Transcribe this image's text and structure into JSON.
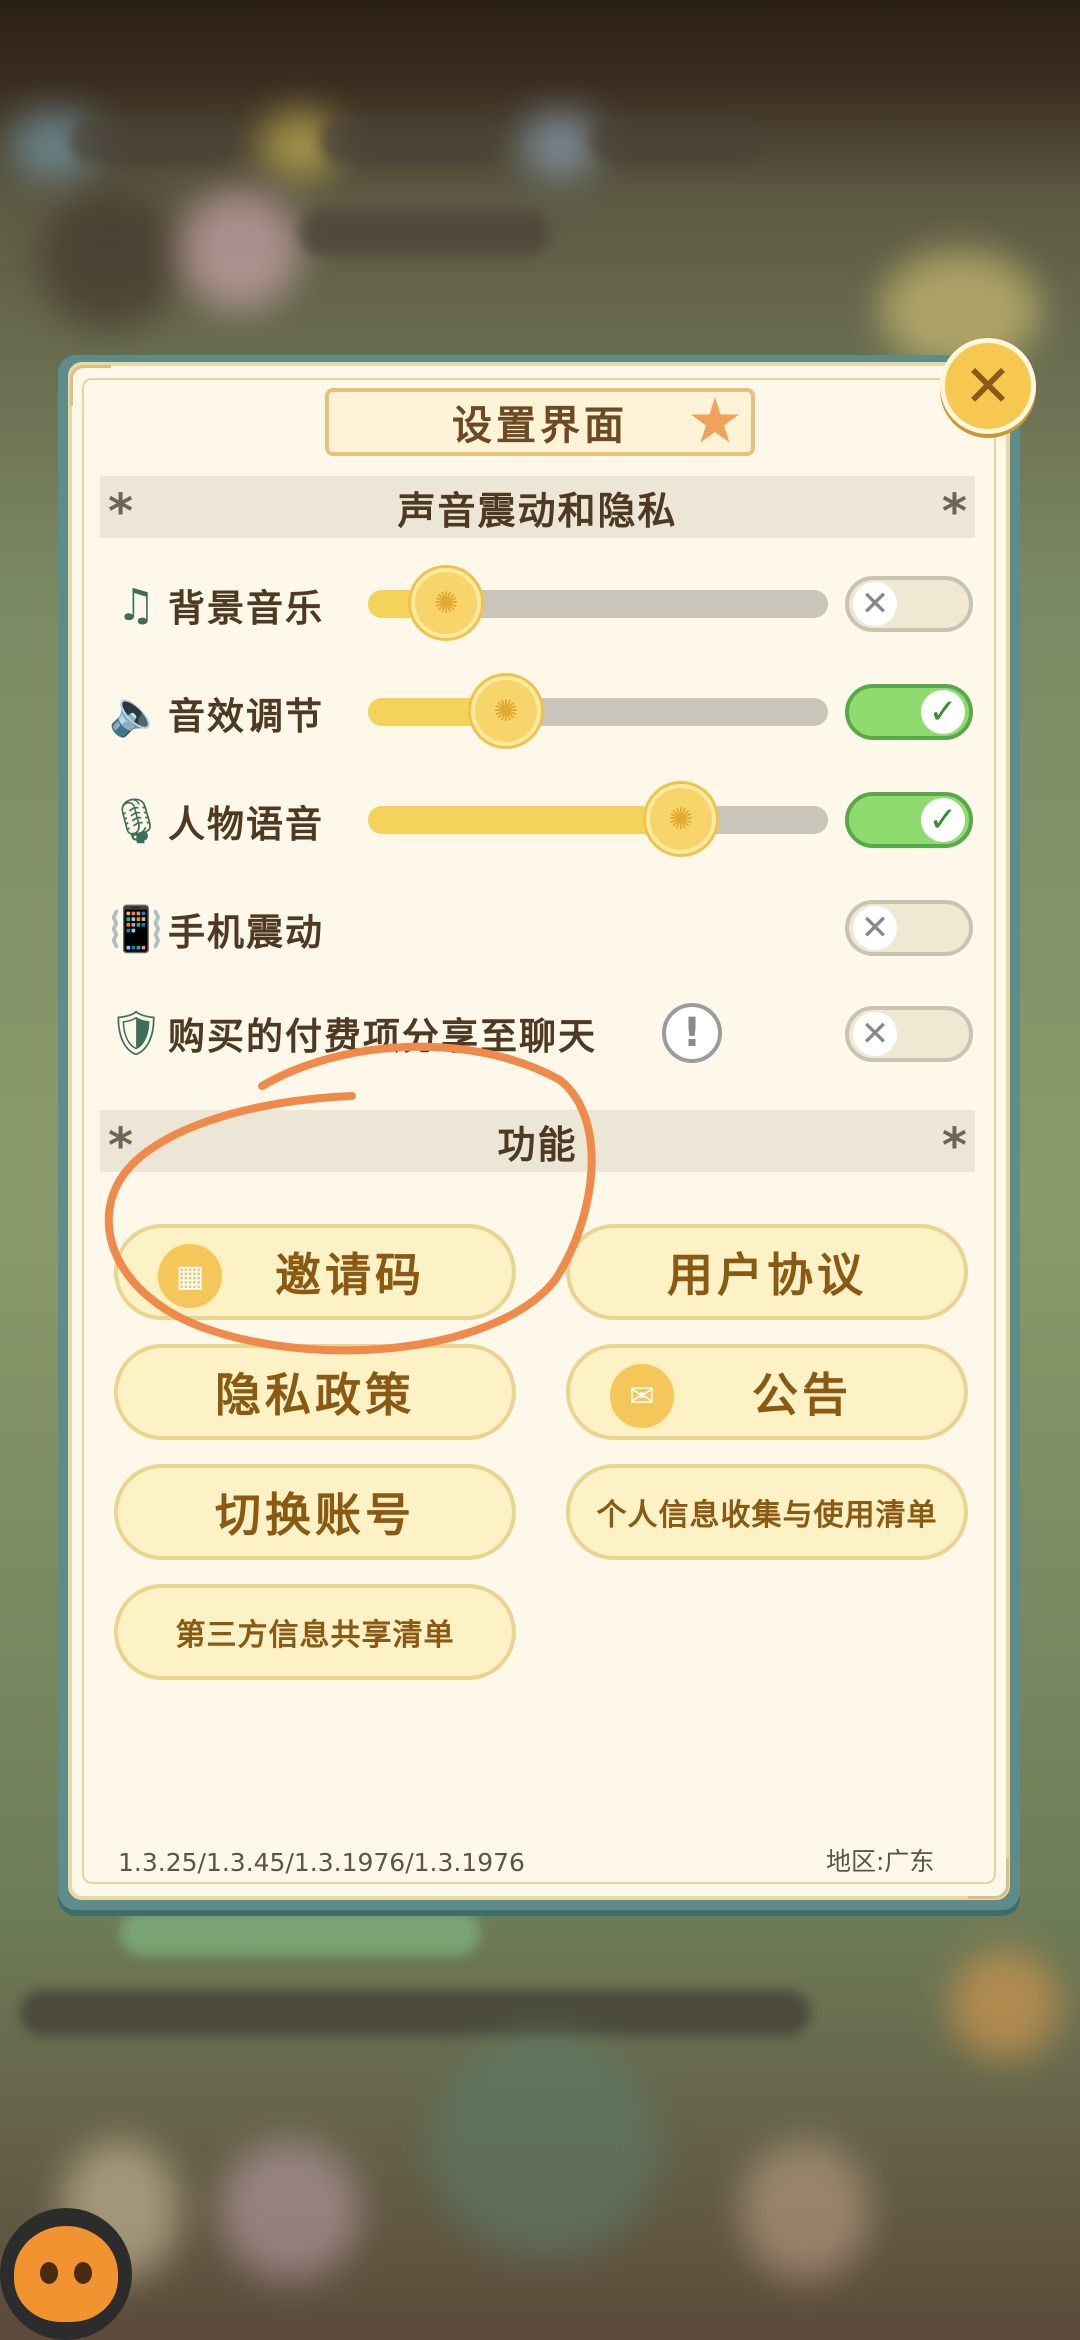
{
  "dialog": {
    "title": "设置界面",
    "close_icon": "close-icon"
  },
  "sound_section": {
    "title": "声音震动和隐私",
    "rows": [
      {
        "label": "背景音乐",
        "icon": "music-note-icon",
        "slider_level": 0.17,
        "enabled": false
      },
      {
        "label": "音效调节",
        "icon": "speaker-icon",
        "slider_level": 0.3,
        "enabled": true
      },
      {
        "label": "人物语音",
        "icon": "microphone-icon",
        "slider_level": 0.68,
        "enabled": true
      },
      {
        "label": "手机震动",
        "icon": "phone-vibrate-icon",
        "enabled": false
      },
      {
        "label": "购买的付费项分享至聊天",
        "icon": "shield-icon",
        "enabled": false
      }
    ]
  },
  "function_section": {
    "title": "功能",
    "buttons": [
      {
        "label": "邀请码",
        "icon": "invite-code-icon"
      },
      {
        "label": "用户协议"
      },
      {
        "label": "隐私政策"
      },
      {
        "label": "公告",
        "icon": "announcement-icon"
      },
      {
        "label": "切换账号"
      },
      {
        "label": "个人信息收集与使用清单"
      },
      {
        "label": "第三方信息共享清单"
      }
    ]
  },
  "footer": {
    "version": "1.3.25/1.3.45/1.3.1976/1.3.1976",
    "region": "地区:广东"
  },
  "colors": {
    "panel_bg": "#fdf8ea",
    "panel_frame": "#5d8c8a",
    "toggle_on": "#8ddc6d",
    "slider_fill": "#f5d25a",
    "button_text": "#8a5a12",
    "annotation": "#f08a4b"
  }
}
